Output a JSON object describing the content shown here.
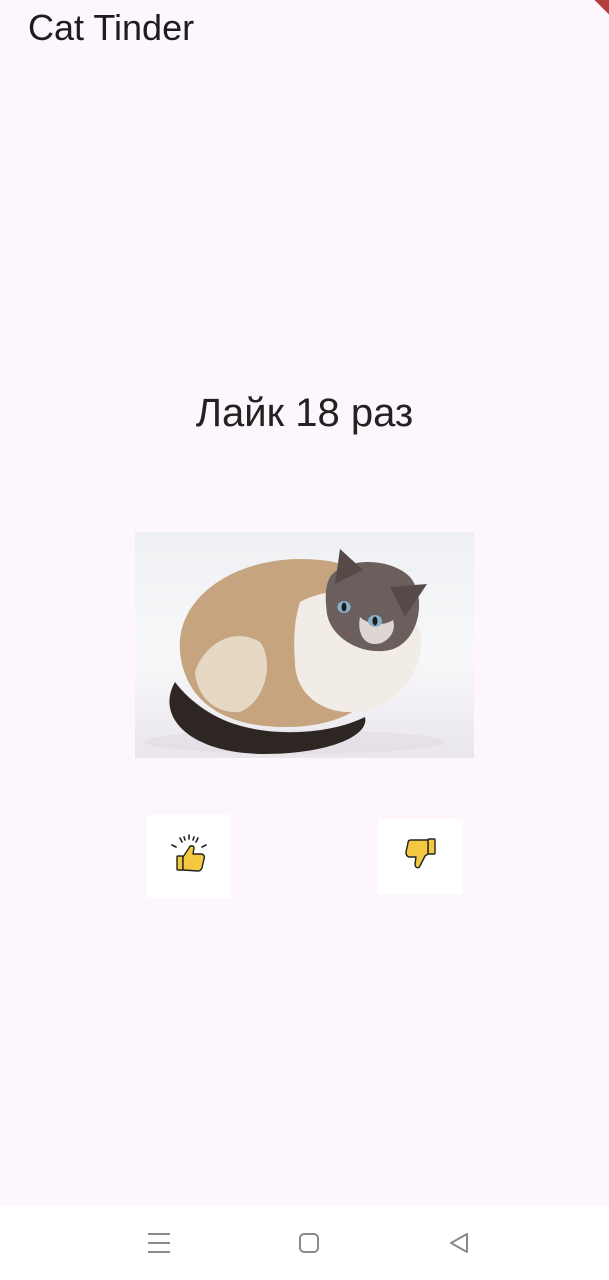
{
  "app": {
    "title": "Cat Tinder"
  },
  "main": {
    "like_counter_text": "Лайк 18 раз",
    "cat_image": "cat-photo",
    "like_button_icon": "thumbs-up-icon",
    "dislike_button_icon": "thumbs-down-icon"
  },
  "system_nav": {
    "menu_icon": "menu-icon",
    "home_icon": "home-icon",
    "back_icon": "back-icon"
  },
  "colors": {
    "background": "#fdf6fc",
    "button_background": "#ffffff",
    "thumb_yellow": "#f5c842",
    "debug_ribbon": "#b3403f"
  }
}
